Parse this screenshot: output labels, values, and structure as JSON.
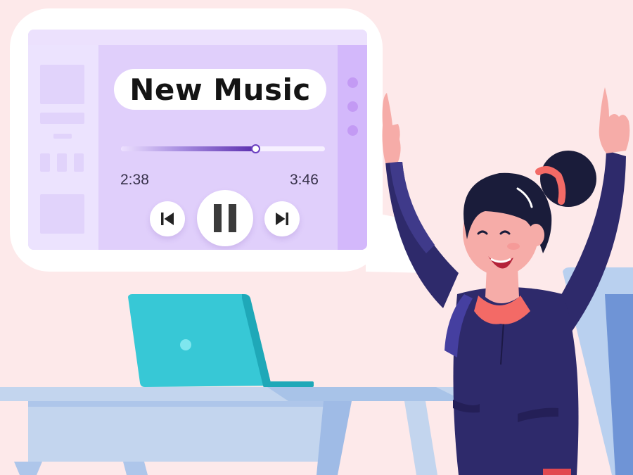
{
  "player": {
    "title": "New Music",
    "elapsed": "2:38",
    "total": "3:46",
    "progress_fraction": 0.66,
    "state": "playing",
    "controls": {
      "previous_icon": "skip-previous-icon",
      "pause_icon": "pause-icon",
      "next_icon": "skip-next-icon"
    }
  },
  "colors": {
    "background": "#fde9ea",
    "app_main": "#e0cffb",
    "progress_accent": "#5b2eae",
    "laptop": "#37c8d6",
    "sweater": "#2e2a6b",
    "collar": "#f36a66"
  }
}
